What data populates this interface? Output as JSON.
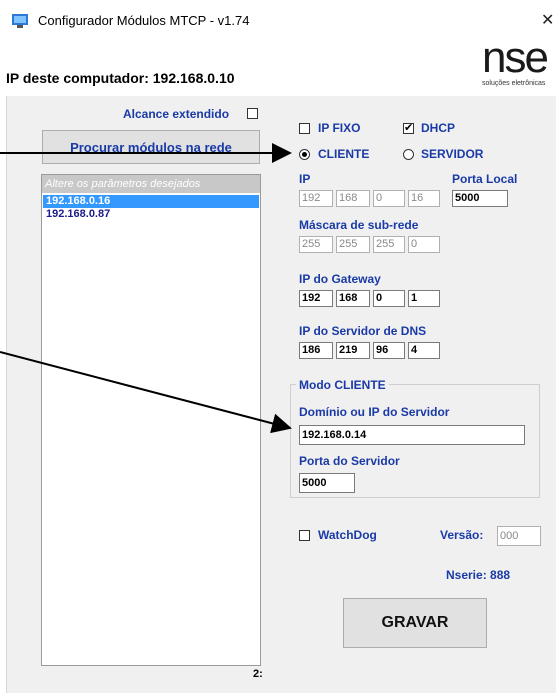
{
  "window": {
    "title": "Configurador Módulos MTCP - v1.74",
    "close_glyph": "✕"
  },
  "header": {
    "ip_label": "IP deste computador: 192.168.0.10",
    "logo_text": "nse",
    "logo_subtitle": "soluções eletrônicas"
  },
  "left": {
    "alcance_label": "Alcance extendido",
    "alcance_checked": false,
    "search_button": "Procurar módulos na rede",
    "list_header": "Altere os parâmetros desejados",
    "modules": [
      "192.168.0.16",
      "192.168.0.87"
    ],
    "selected_index": 0,
    "count_label": "2:"
  },
  "right": {
    "ip_fixo_label": "IP FIXO",
    "ip_fixo_checked": false,
    "dhcp_label": "DHCP",
    "dhcp_checked": true,
    "cliente_label": "CLIENTE",
    "servidor_label": "SERVIDOR",
    "mode_selected": "CLIENTE",
    "ip_label": "IP",
    "ip": [
      "192",
      "168",
      "0",
      "16"
    ],
    "porta_local_label": "Porta Local",
    "porta_local": "5000",
    "mascara_label": "Máscara de sub-rede",
    "mascara": [
      "255",
      "255",
      "255",
      "0"
    ],
    "gateway_label": "IP do Gateway",
    "gateway": [
      "192",
      "168",
      "0",
      "1"
    ],
    "dns_label": "IP do Servidor de DNS",
    "dns": [
      "186",
      "219",
      "96",
      "4"
    ],
    "modo_group_title": "Modo CLIENTE",
    "dominio_label": "Domínio ou IP do Servidor",
    "dominio": "192.168.0.14",
    "porta_servidor_label": "Porta do Servidor",
    "porta_servidor": "5000",
    "watchdog_label": "WatchDog",
    "watchdog_checked": false,
    "versao_label": "Versão:",
    "versao": "000",
    "nserie_label": "Nserie: 888",
    "gravar_button": "GRAVAR"
  },
  "colors": {
    "label_blue": "#1a3aa6",
    "selection": "#3399ff",
    "panel_bg": "#f0f0f0"
  }
}
